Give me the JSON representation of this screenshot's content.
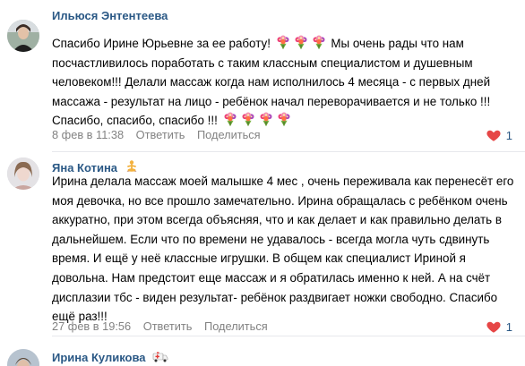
{
  "comments": [
    {
      "author": "Ильюся Энтентеева",
      "text_a": "Спасибо Ирине Юрьевне за ее работу!",
      "text_b": "Мы очень рады что нам посчастливилось поработать с таким классным специалистом и душевным человеком!!! Делали массаж когда нам исполнилось 4 месяца - с первых дней массажа - результат на лицо - ребёнок начал переворачивается и не только !!! Спасибо, спасибо, спасибо !!!",
      "date": "8 фев в 11:38",
      "reply": "Ответить",
      "share": "Поделиться",
      "likes": "1",
      "emoji_icon": "bouquet-icon"
    },
    {
      "author": "Яна Котина",
      "author_badge_icon": "yoga-person-icon",
      "text": "Ирина делала массаж моей малышке 4 мес , очень переживала как перенесёт его моя девочка, но все прошло замечательно. Ирина обращалась с ребёнком очень аккуратно, при этом всегда объясняя, что и как делает и как правильно делать в дальнейшем. Если что по времени не удавалось - всегда могла чуть сдвинуть время. И ещё у неё классные игрушки. В общем как специалист Ириной я довольна. Нам предстоит еще массаж и я обратилась именно к ней. А на счёт дисплазии тбс - виден результат- ребёнок раздвигает ножки свободно. Спасибо ещё раз!!!",
      "date": "27 фев в 19:56",
      "reply": "Ответить",
      "share": "Поделиться",
      "likes": "1"
    },
    {
      "author": "Ирина Куликова",
      "author_badge_icon": "ambulance-icon"
    }
  ],
  "colors": {
    "author_link": "#2a5885",
    "meta_text": "#828282",
    "like_heart": "#e64646",
    "separator": "#e7e8ec"
  }
}
